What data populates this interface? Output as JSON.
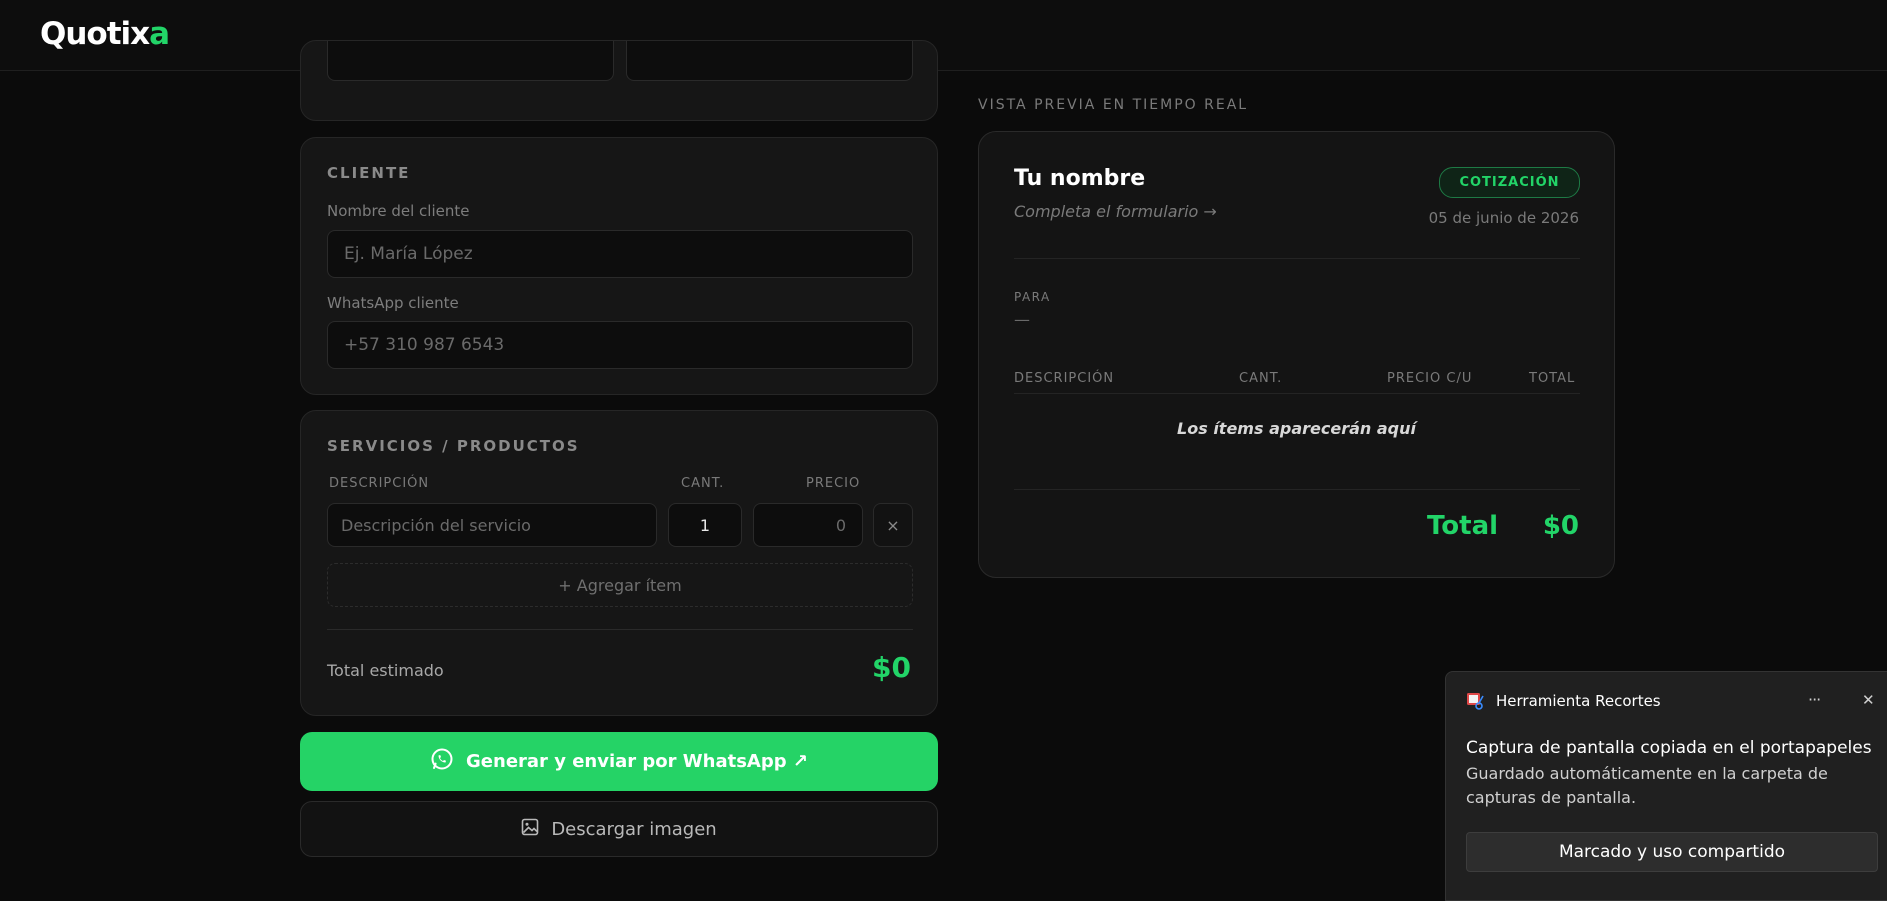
{
  "app": {
    "logo_main": "Quotix",
    "logo_accent": "a"
  },
  "cliente": {
    "section_title": "CLIENTE",
    "name_label": "Nombre del cliente",
    "name_placeholder": "Ej. María López",
    "whatsapp_label": "WhatsApp cliente",
    "whatsapp_placeholder": "+57 310 987 6543"
  },
  "servicios": {
    "section_title": "SERVICIOS / PRODUCTOS",
    "col_description": "DESCRIPCIÓN",
    "col_qty": "CANT.",
    "col_price": "PRECIO",
    "item_description_placeholder": "Descripción del servicio",
    "item_qty": "1",
    "item_price_placeholder": "0",
    "remove_icon": "×",
    "add_item_label": "+ Agregar ítem",
    "total_label": "Total estimado",
    "total_value": "$0"
  },
  "actions": {
    "whatsapp_label": "Generar y enviar por WhatsApp ↗",
    "download_label": "Descargar imagen"
  },
  "preview": {
    "section_label": "VISTA PREVIA EN TIEMPO REAL",
    "name": "Tu nombre",
    "subtitle": "Completa el formulario →",
    "badge": "COTIZACIÓN",
    "date": "05 de junio de 2026",
    "para_label": "PARA",
    "para_value": "—",
    "col_description": "DESCRIPCIÓN",
    "col_qty": "CANT.",
    "col_unit_price": "PRECIO C/U",
    "col_total": "TOTAL",
    "empty_message": "Los ítems aparecerán aquí",
    "total_label": "Total",
    "total_value": "$0"
  },
  "toast": {
    "app_name": "Herramienta Recortes",
    "more_icon": "···",
    "close_icon": "✕",
    "title": "Captura de pantalla copiada en el portapapeles",
    "body": "Guardado automáticamente en la carpeta de capturas de pantalla.",
    "button_label": "Marcado y uso compartido"
  },
  "colors": {
    "accent": "#25d366",
    "background": "#0b0b0b",
    "card": "#161616"
  }
}
